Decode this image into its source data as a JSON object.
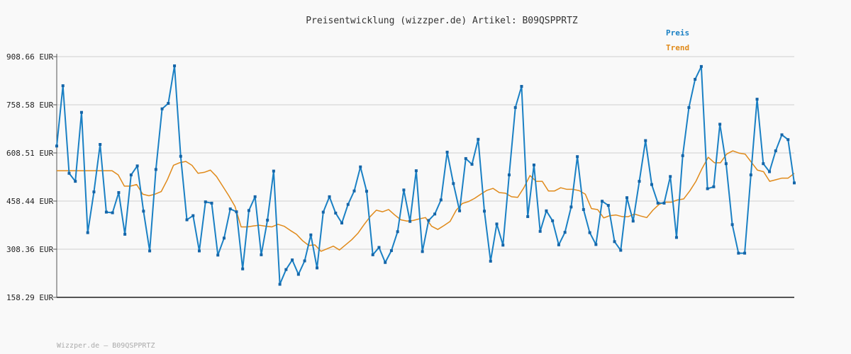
{
  "chart_data": {
    "type": "line",
    "title": "Preisentwicklung (wizzper.de) Artikel: B09QSPPRTZ",
    "xlabel": "",
    "ylabel": "",
    "y_ticks": [
      "908.66 EUR",
      "758.58 EUR",
      "608.51 EUR",
      "458.44 EUR",
      "308.36 EUR",
      "158.29 EUR"
    ],
    "y_tick_values": [
      908.66,
      758.58,
      608.51,
      458.44,
      308.36,
      158.29
    ],
    "ylim": [
      158.29,
      908.66
    ],
    "grid": true,
    "legend_placement": "top-right",
    "series": [
      {
        "name": "Preis",
        "color": "#1a80c4",
        "values": [
          630,
          818,
          545,
          520,
          735,
          360,
          487,
          635,
          424,
          422,
          485,
          355,
          540,
          568,
          427,
          303,
          557,
          746,
          763,
          880,
          598,
          400,
          413,
          303,
          456,
          452,
          290,
          343,
          434,
          425,
          247,
          429,
          472,
          291,
          399,
          552,
          199,
          245,
          275,
          230,
          272,
          353,
          250,
          424,
          472,
          421,
          390,
          448,
          490,
          565,
          489,
          291,
          314,
          267,
          304,
          363,
          493,
          395,
          553,
          301,
          398,
          418,
          462,
          611,
          513,
          428,
          591,
          573,
          651,
          427,
          271,
          387,
          321,
          540,
          750,
          816,
          410,
          571,
          364,
          428,
          397,
          322,
          361,
          440,
          597,
          432,
          360,
          323,
          458,
          445,
          332,
          305,
          469,
          396,
          520,
          647,
          510,
          452,
          452,
          535,
          345,
          600,
          750,
          838,
          878,
          497,
          503,
          698,
          575,
          385,
          296,
          296,
          540,
          776,
          575,
          550,
          615,
          665,
          650,
          515
        ]
      },
      {
        "name": "Trend",
        "color": "#e08a1a",
        "values": [
          553,
          553,
          553,
          553,
          553,
          553,
          553,
          553,
          553,
          553,
          540,
          505,
          505,
          510,
          480,
          475,
          480,
          488,
          525,
          570,
          578,
          582,
          570,
          545,
          548,
          555,
          535,
          505,
          475,
          442,
          378,
          378,
          381,
          383,
          380,
          378,
          386,
          380,
          367,
          355,
          335,
          320,
          322,
          302,
          310,
          318,
          306,
          322,
          338,
          358,
          385,
          410,
          430,
          425,
          432,
          415,
          400,
          396,
          398,
          403,
          407,
          380,
          370,
          382,
          395,
          430,
          451,
          457,
          467,
          480,
          492,
          498,
          485,
          483,
          472,
          470,
          500,
          538,
          520,
          520,
          490,
          490,
          500,
          495,
          495,
          491,
          480,
          435,
          432,
          406,
          413,
          415,
          410,
          410,
          418,
          412,
          407,
          430,
          448,
          455,
          455,
          462,
          465,
          490,
          520,
          560,
          595,
          578,
          578,
          605,
          615,
          608,
          605,
          580,
          555,
          550,
          520,
          525,
          530,
          530,
          545
        ]
      }
    ]
  },
  "footer_text": "Wizzper.de – B09QSPPRTZ"
}
